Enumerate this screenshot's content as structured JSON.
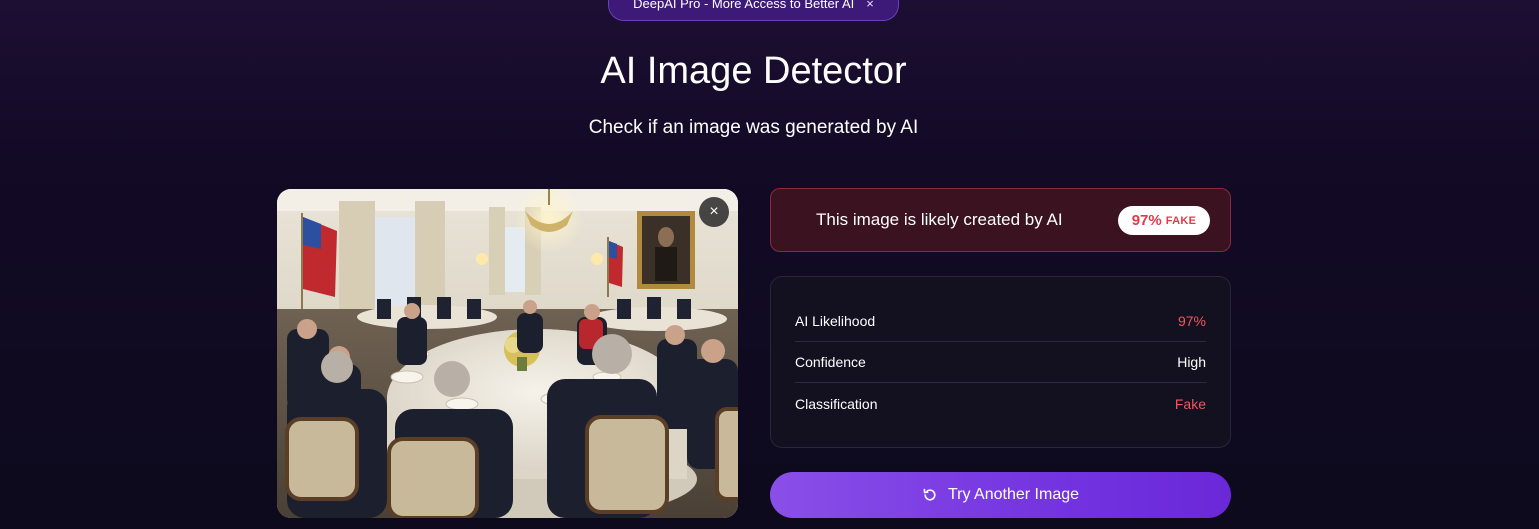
{
  "banner": {
    "text": "DeepAI Pro - More Access to Better AI",
    "close_symbol": "×"
  },
  "header": {
    "title": "AI Image Detector",
    "subtitle": "Check if an image was generated by AI"
  },
  "image_panel": {
    "close_symbol": "×",
    "icon": "close-icon"
  },
  "result": {
    "message": "This image is likely created by AI",
    "percent": "97%",
    "label": "FAKE",
    "accent_color": "#e03c4a"
  },
  "details": [
    {
      "label": "AI Likelihood",
      "value": "97%",
      "highlight": true
    },
    {
      "label": "Confidence",
      "value": "High",
      "highlight": false
    },
    {
      "label": "Classification",
      "value": "Fake",
      "highlight": true
    }
  ],
  "action": {
    "label": "Try Another Image",
    "icon": "refresh-icon"
  },
  "colors": {
    "background": "#130a26",
    "button": "#7434e0",
    "danger": "#f0575e"
  }
}
